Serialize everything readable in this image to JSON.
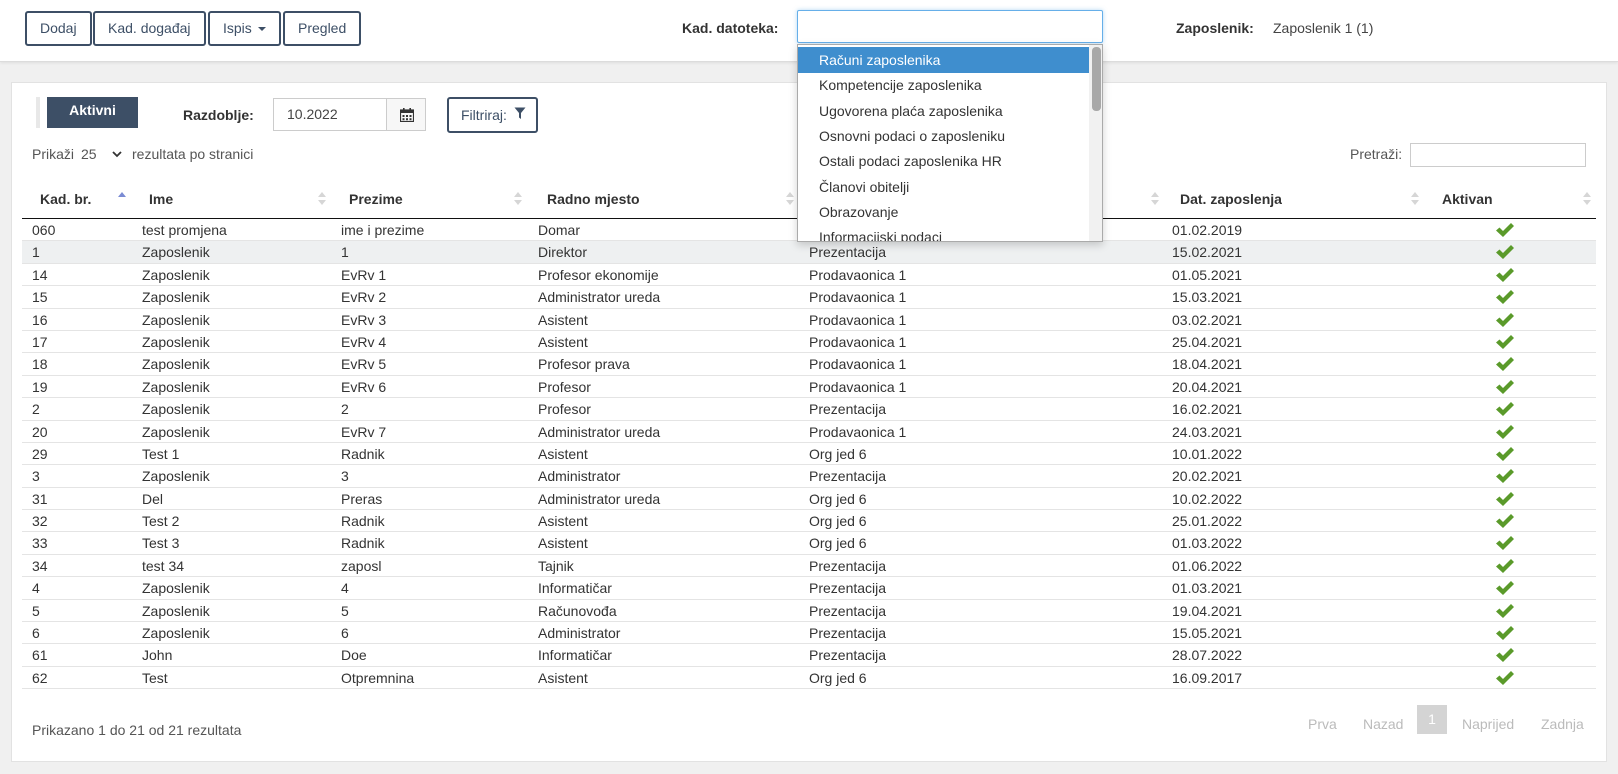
{
  "toolbar": {
    "add_label": "Dodaj",
    "event_label": "Kad. događaj",
    "print_label": "Ispis",
    "view_label": "Pregled"
  },
  "kad_datoteka": {
    "label": "Kad. datoteka:",
    "value": "",
    "options": [
      "Računi zaposlenika",
      "Kompetencije zaposlenika",
      "Ugovorena plaća zaposlenika",
      "Osnovni podaci o zaposleniku",
      "Ostali podaci zaposlenika HR",
      "Članovi obitelji",
      "Obrazovanje",
      "Informacijski podaci"
    ],
    "selected_index": 0
  },
  "employee": {
    "label": "Zaposlenik:",
    "value": "Zaposlenik 1 (1)"
  },
  "filters": {
    "active_tab": "Aktivni",
    "period_label": "Razdoblje:",
    "period_value": "10.2022",
    "filter_label": "Filtriraj:"
  },
  "length": {
    "prefix": "Prikaži",
    "value": "25",
    "suffix": "rezultata po stranici"
  },
  "search": {
    "label": "Pretraži:",
    "value": ""
  },
  "table": {
    "headers": [
      "Kad. br.",
      "Ime",
      "Prezime",
      "Radno mjesto",
      "",
      "Dat. zaposlenja",
      "Aktivan"
    ],
    "rows": [
      [
        "060",
        "test promjena",
        "ime i prezime",
        "Domar",
        "",
        "01.02.2019"
      ],
      [
        "1",
        "Zaposlenik",
        "1",
        "Direktor",
        "Prezentacija",
        "15.02.2021"
      ],
      [
        "14",
        "Zaposlenik",
        "EvRv 1",
        "Profesor ekonomije",
        "Prodavaonica 1",
        "01.05.2021"
      ],
      [
        "15",
        "Zaposlenik",
        "EvRv 2",
        "Administrator ureda",
        "Prodavaonica 1",
        "15.03.2021"
      ],
      [
        "16",
        "Zaposlenik",
        "EvRv 3",
        "Asistent",
        "Prodavaonica 1",
        "03.02.2021"
      ],
      [
        "17",
        "Zaposlenik",
        "EvRv 4",
        "Asistent",
        "Prodavaonica 1",
        "25.04.2021"
      ],
      [
        "18",
        "Zaposlenik",
        "EvRv 5",
        "Profesor prava",
        "Prodavaonica 1",
        "18.04.2021"
      ],
      [
        "19",
        "Zaposlenik",
        "EvRv 6",
        "Profesor",
        "Prodavaonica 1",
        "20.04.2021"
      ],
      [
        "2",
        "Zaposlenik",
        "2",
        "Profesor",
        "Prezentacija",
        "16.02.2021"
      ],
      [
        "20",
        "Zaposlenik",
        "EvRv 7",
        "Administrator ureda",
        "Prodavaonica 1",
        "24.03.2021"
      ],
      [
        "29",
        "Test 1",
        "Radnik",
        "Asistent",
        "Org jed 6",
        "10.01.2022"
      ],
      [
        "3",
        "Zaposlenik",
        "3",
        "Administrator",
        "Prezentacija",
        "20.02.2021"
      ],
      [
        "31",
        "Del",
        "Preras",
        "Administrator ureda",
        "Org jed 6",
        "10.02.2022"
      ],
      [
        "32",
        "Test 2",
        "Radnik",
        "Asistent",
        "Org jed 6",
        "25.01.2022"
      ],
      [
        "33",
        "Test 3",
        "Radnik",
        "Asistent",
        "Org jed 6",
        "01.03.2022"
      ],
      [
        "34",
        "test 34",
        "zaposl",
        "Tajnik",
        "Prezentacija",
        "01.06.2022"
      ],
      [
        "4",
        "Zaposlenik",
        "4",
        "Informatičar",
        "Prezentacija",
        "01.03.2021"
      ],
      [
        "5",
        "Zaposlenik",
        "5",
        "Računovođa",
        "Prezentacija",
        "19.04.2021"
      ],
      [
        "6",
        "Zaposlenik",
        "6",
        "Administrator",
        "Prezentacija",
        "15.05.2021"
      ],
      [
        "61",
        "John",
        "Doe",
        "Informatičar",
        "Prezentacija",
        "28.07.2022"
      ],
      [
        "62",
        "Test",
        "Otpremnina",
        "Asistent",
        "Org jed 6",
        "16.09.2017"
      ]
    ],
    "highlighted_row": 1
  },
  "footer": {
    "info": "Prikazano 1 do 21 od 21 rezultata",
    "first": "Prva",
    "prev": "Nazad",
    "current": "1",
    "next": "Naprijed",
    "last": "Zadnja"
  },
  "icons": {
    "calendar": "calendar-icon",
    "filter": "funnel-icon",
    "active": "check-icon",
    "sort": "sort-icon"
  },
  "colors": {
    "primary": "#3d4f66",
    "selection": "#3f8ece",
    "check": "#5a9a2a"
  }
}
